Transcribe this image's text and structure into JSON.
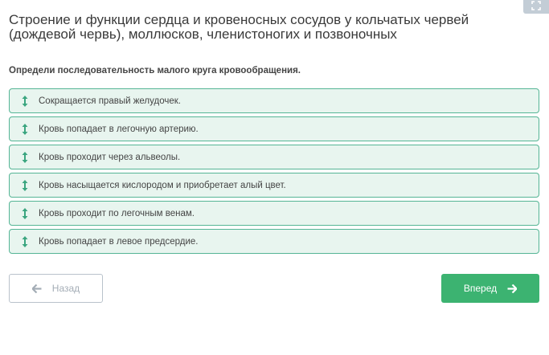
{
  "header": {
    "title": "Строение и функции сердца и кровеносных сосудов у кольчатых червей (дождевой червь), моллюсков, членистоногих и позвоночных",
    "corner_icon": "expand-icon"
  },
  "question": {
    "text": "Определи последовательность малого круга кровообращения."
  },
  "answers": [
    {
      "label": "Сокращается правый желудочек.",
      "icon": "drag-arrows-icon"
    },
    {
      "label": "Кровь попадает в легочную артерию.",
      "icon": "drag-arrows-icon"
    },
    {
      "label": "Кровь проходит через альвеолы.",
      "icon": "drag-arrows-icon"
    },
    {
      "label": "Кровь насыщается кислородом и приобретает алый цвет.",
      "icon": "drag-arrows-icon"
    },
    {
      "label": "Кровь проходит по легочным венам.",
      "icon": "drag-arrows-icon"
    },
    {
      "label": "Кровь попадает в левое предсердие.",
      "icon": "drag-arrows-icon"
    }
  ],
  "navigation": {
    "back_label": "Назад",
    "back_icon": "arrow-left-icon",
    "next_label": "Вперед",
    "next_icon": "arrow-right-icon"
  },
  "colors": {
    "accent_green": "#3cb371",
    "item_border": "#55b595",
    "item_background": "#e8f5ef",
    "disabled_gray": "#a4adb6"
  }
}
